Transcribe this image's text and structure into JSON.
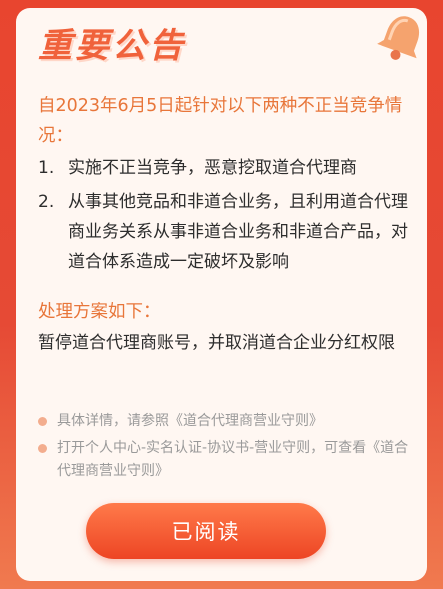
{
  "notice": {
    "title": "重要公告",
    "intro": "自2023年6月5日起针对以下两种不正当竞争情况：",
    "items": [
      {
        "num": "1.",
        "text": "实施不正当竞争，恶意挖取道合代理商"
      },
      {
        "num": "2.",
        "text": "从事其他竞品和非道合业务，且利用道合代理商业务关系从事非道合业务和非道合产品，对道合体系造成一定破坏及影响"
      }
    ],
    "plan_heading": "处理方案如下：",
    "plan_text": "暂停道合代理商账号，并取消道合企业分红权限",
    "notes": [
      "具体详情，请参照《道合代理商营业守则》",
      "打开个人中心-实名认证-协议书-营业守则，可查看《道合代理商营业守则》"
    ],
    "button_label": "已阅读"
  },
  "colors": {
    "background": "#e8452f",
    "accent": "#e8763a",
    "title": "#f0623b",
    "button": "#ed4524"
  },
  "icons": {
    "corner": "bell-icon"
  }
}
